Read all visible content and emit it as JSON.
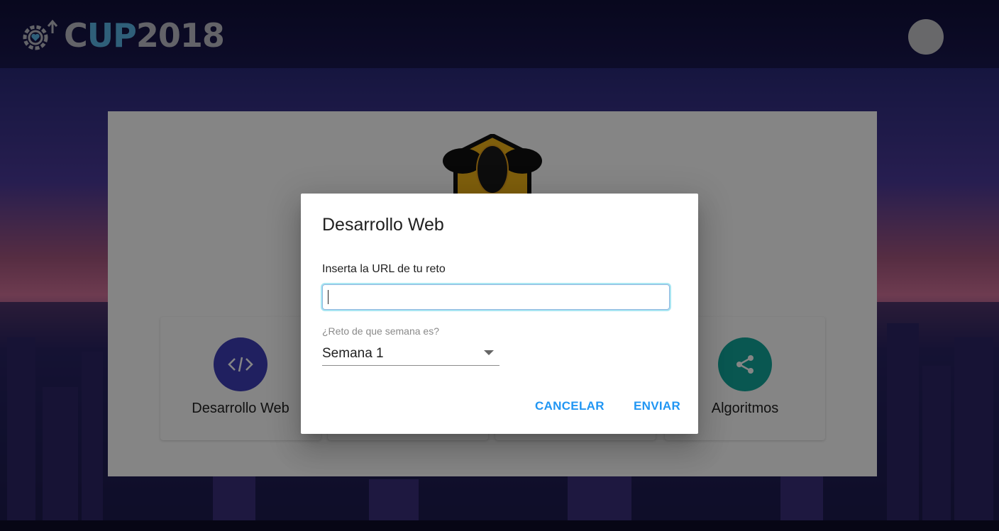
{
  "header": {
    "logo_text_left": "C",
    "logo_text_up": "UP",
    "logo_text_right": "2018",
    "logo_icon": "gear-heart-icon",
    "avatar_icon": "user-avatar"
  },
  "cards": [
    {
      "label": "Desarrollo Web",
      "icon": "code-icon",
      "color": "#3f3fb8"
    },
    {
      "label": "Algoritmos",
      "icon": "share-icon",
      "color": "#13a89b"
    }
  ],
  "dialog": {
    "title": "Desarrollo Web",
    "url_label": "Inserta la URL de tu reto",
    "url_value": "",
    "week_label": "¿Reto de que semana es?",
    "week_value": "Semana 1",
    "cancel_label": "CANCELAR",
    "submit_label": "ENVIAR",
    "accent_color": "#2196f3"
  }
}
